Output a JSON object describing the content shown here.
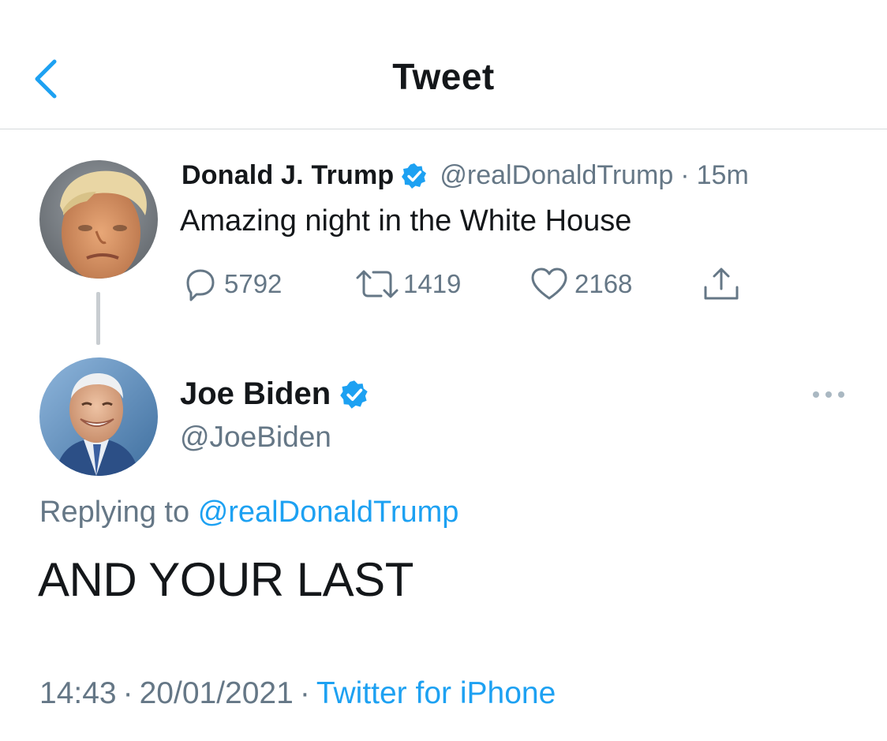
{
  "header": {
    "title": "Tweet",
    "back_icon": "chevron-left-icon",
    "accent_color": "#1da1f2"
  },
  "parent_tweet": {
    "author_name": "Donald J. Trump",
    "verified": true,
    "handle": "@realDonaldTrump",
    "separator": "·",
    "time": "15m",
    "text": "Amazing night in the White House",
    "replies": "5792",
    "retweets": "1419",
    "likes": "2168",
    "icons": [
      "reply-icon",
      "retweet-icon",
      "like-icon",
      "share-icon"
    ]
  },
  "main_tweet": {
    "author_name": "Joe Biden",
    "verified": true,
    "handle": "@JoeBiden",
    "replying_to_label": "Replying to",
    "replying_to_handle": "@realDonaldTrump",
    "text": "AND YOUR LAST",
    "time": "14:43",
    "date": "20/01/2021",
    "separator": "·",
    "source": "Twitter for iPhone",
    "more_icon": "more-horizontal-icon"
  }
}
